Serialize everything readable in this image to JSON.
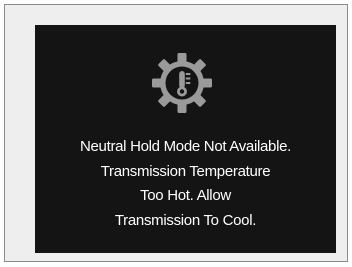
{
  "display": {
    "icon": "transmission-temperature-gear-icon",
    "message_lines": [
      "Neutral Hold Mode Not Available.",
      "Transmission Temperature",
      "Too Hot. Allow",
      "Transmission To Cool."
    ]
  },
  "colors": {
    "screen_background": "#141414",
    "text": "#ffffff",
    "icon": "#9a9a9a",
    "frame_background": "#eeeeee",
    "frame_border": "#8a8a8a"
  }
}
